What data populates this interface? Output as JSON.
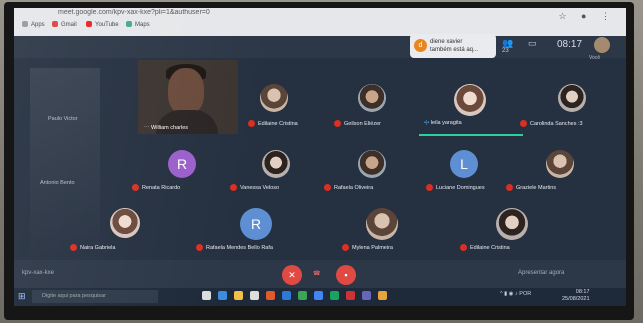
{
  "browser": {
    "url_text": "meet.google.com/kpv-xax-kxe?pli=1&authuser=0",
    "bookmarks": [
      "Apps",
      "Gmail",
      "YouTube",
      "Maps"
    ]
  },
  "meet_header": {
    "toast_initial": "d",
    "toast_text_line1": "diene xavier",
    "toast_text_line2": "também está aq...",
    "participants_count": "23",
    "clock": "08:17",
    "self_label": "Você"
  },
  "self_view": {
    "name": "William charles"
  },
  "participants": [
    {
      "name": "Edilaine Cristina",
      "type": "photo"
    },
    {
      "name": "Geilson Eliézer",
      "type": "photo"
    },
    {
      "name": "leila yaragita",
      "type": "photo"
    },
    {
      "name": "Carolinda Sanches :3",
      "type": "photo"
    },
    {
      "name": "Renata Ricardo",
      "type": "initial",
      "initial": "R"
    },
    {
      "name": "Vanessa Veloso",
      "type": "photo"
    },
    {
      "name": "Rafaela Oliveira",
      "type": "photo"
    },
    {
      "name": "Luciane Domingues",
      "type": "initial",
      "initial": "L"
    },
    {
      "name": "Graziele Martins",
      "type": "photo"
    },
    {
      "name": "Naira Gabriela",
      "type": "photo"
    },
    {
      "name": "Rafaela Mendes Bello Rafa",
      "type": "initial",
      "initial": "R"
    },
    {
      "name": "Mylena Palmeira",
      "type": "photo"
    },
    {
      "name": "Edilaine Cristina",
      "type": "photo"
    }
  ],
  "ghost_names": [
    "Paulo Victor",
    "Antonio Bento"
  ],
  "controls": {
    "left_label": "kpv-xax-kxe",
    "right_label": "Apresentar agora"
  },
  "taskbar": {
    "search_placeholder": "Digite aqui para pesquisar",
    "tray_lang": "POR",
    "tray_time": "08:17",
    "tray_date": "25/08/2021"
  },
  "colors": {
    "mic_off": "#d93025",
    "speaking": "#2bd0a0",
    "end_call": "#e04a42"
  }
}
